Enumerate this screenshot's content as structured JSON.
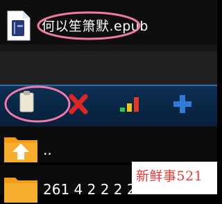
{
  "file": {
    "name": "何以笙箫默.epub",
    "icon": "epub-book-icon"
  },
  "toolbar": {
    "buttons": [
      {
        "id": "paste",
        "icon": "clipboard-icon"
      },
      {
        "id": "delete",
        "icon": "red-x-icon"
      },
      {
        "id": "signal",
        "icon": "signal-bars-icon"
      },
      {
        "id": "add",
        "icon": "blue-plus-icon"
      }
    ]
  },
  "list": {
    "parent": {
      "label": "..",
      "icon": "folder-up-icon"
    },
    "next": {
      "label": "261 4 2 2 2 2 2 2 2",
      "icon": "folder-icon"
    }
  },
  "watermark": {
    "text": "新鲜事521"
  },
  "colors": {
    "highlight_oval": "#f07aa8",
    "toolbar_bg": "#0a2848",
    "folder_orange": "#f39c1a",
    "delete_red": "#d92828",
    "add_blue": "#2f7bd8",
    "watermark_text": "#e63a3a"
  }
}
